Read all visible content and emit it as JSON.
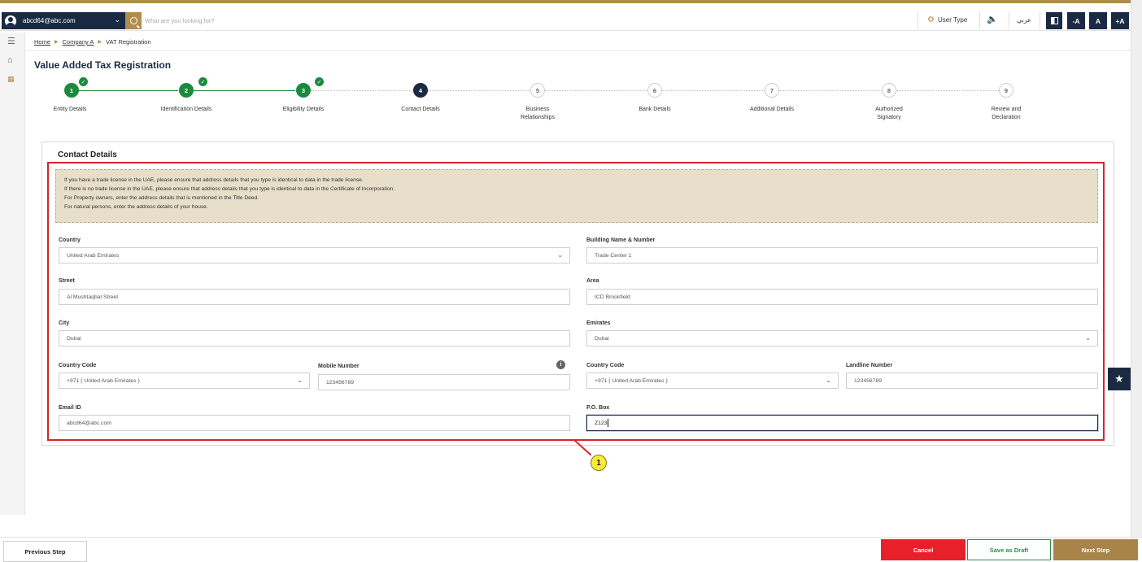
{
  "topbar": {
    "user_email": "abcd64@abc.com",
    "search_placeholder": "What are you looking for?",
    "user_type_label": "User Type",
    "language_label": "عربي",
    "font_decrease": "-A",
    "font_normal": "A",
    "font_increase": "+A"
  },
  "breadcrumb": [
    "Home",
    "Company A",
    "VAT Registration"
  ],
  "page_title": "Value Added Tax Registration",
  "steps": [
    {
      "number": "1",
      "label": "Entity Details",
      "status": "done"
    },
    {
      "number": "2",
      "label": "Identification Details",
      "status": "done"
    },
    {
      "number": "3",
      "label": "Eligibility Details",
      "status": "done"
    },
    {
      "number": "4",
      "label": "Contact Details",
      "status": "current"
    },
    {
      "number": "5",
      "label_line1": "Business",
      "label_line2": "Relationships",
      "status": "todo"
    },
    {
      "number": "6",
      "label": "Bank Details",
      "status": "todo"
    },
    {
      "number": "7",
      "label": "Additional Details",
      "status": "todo"
    },
    {
      "number": "8",
      "label_line1": "Authorized",
      "label_line2": "Signatory",
      "status": "todo"
    },
    {
      "number": "9",
      "label_line1": "Review and",
      "label_line2": "Declaration",
      "status": "todo"
    }
  ],
  "section_title": "Contact Details",
  "info_lines": [
    "If you have a trade license in the UAE, please ensure that address details that you type is identical to data in the trade license.",
    "If there is no trade license in the UAE, please ensure that address details that you type is identical to data in the Certificate of Incorporation.",
    "For Property owners, enter the address details that is mentioned in the Title Deed.",
    "For natural persons, enter the address details of your house."
  ],
  "form": {
    "country": {
      "label": "Country",
      "value": "United Arab Emirates"
    },
    "building": {
      "label": "Building Name & Number",
      "value": "Trade Center 1"
    },
    "street": {
      "label": "Street",
      "value": "Al Mushtaqbal Street"
    },
    "area": {
      "label": "Area",
      "value": "ICD Brookfield"
    },
    "city": {
      "label": "City",
      "value": "Dubai"
    },
    "emirates": {
      "label": "Emirates",
      "value": "Dubai"
    },
    "mobile_country_code": {
      "label": "Country Code",
      "value": "+971 ( United Arab Emirates )"
    },
    "mobile_number": {
      "label": "Mobile Number",
      "value": "123456789"
    },
    "landline_country_code": {
      "label": "Country Code",
      "value": "+971 ( United Arab Emirates )"
    },
    "landline_number": {
      "label": "Landline Number",
      "value": "123456789"
    },
    "email": {
      "label": "Email ID",
      "value": "abcd64@abc.com"
    },
    "po_box": {
      "label": "P.O. Box",
      "value": "Z123"
    }
  },
  "annotation_number": "1",
  "footer": {
    "previous_label": "Previous Step",
    "cancel_label": "Cancel",
    "draft_label": "Save as Draft",
    "next_label": "Next Step"
  },
  "colors": {
    "navy": "#1b2a43",
    "gold": "#b08d4c",
    "success": "#1b8a3e",
    "danger": "#e8202a",
    "info_bg": "#e8dfca"
  }
}
